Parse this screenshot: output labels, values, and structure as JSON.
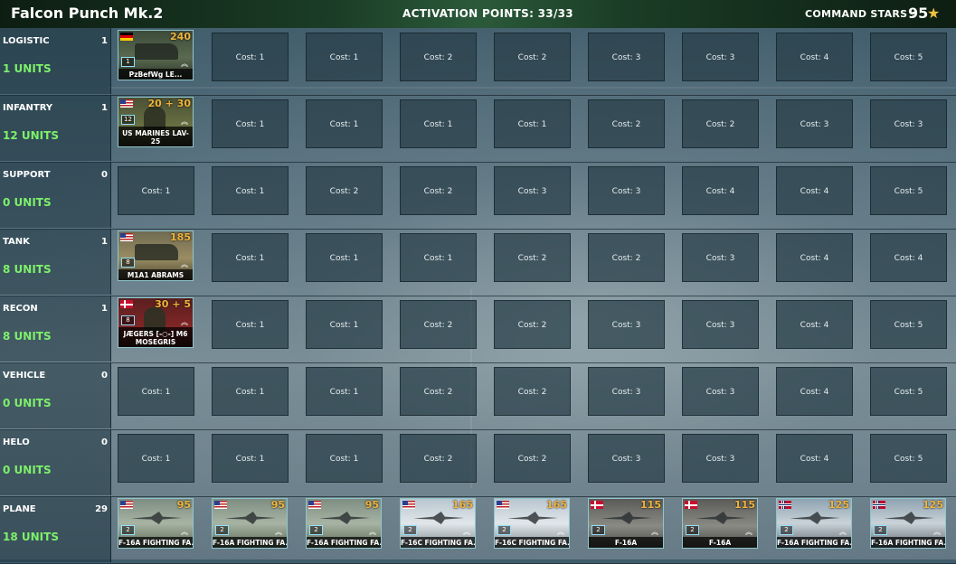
{
  "header": {
    "deck_name": "Falcon Punch Mk.2",
    "activation_points": "ACTIVATION POINTS: 33/33",
    "command_stars_label": "COMMAND STARS :",
    "command_stars_value": "95",
    "star_glyph": "★"
  },
  "rows": [
    {
      "category": "LOGISTIC",
      "count": "1",
      "units": "1 UNITS",
      "card": {
        "name": "PzBefWg LE...",
        "price": "240",
        "qty": "1",
        "flag": "de"
      },
      "slots": [
        "Cost: 1",
        "Cost: 1",
        "Cost: 2",
        "Cost: 2",
        "Cost: 3",
        "Cost: 3",
        "Cost: 4",
        "Cost: 5"
      ]
    },
    {
      "category": "INFANTRY",
      "count": "1",
      "units": "12 UNITS",
      "card": {
        "name": "US MARINES LAV-25",
        "price": "20 + 30",
        "qty": "12",
        "flag": "us"
      },
      "slots": [
        "Cost: 1",
        "Cost: 1",
        "Cost: 1",
        "Cost: 1",
        "Cost: 2",
        "Cost: 2",
        "Cost: 3",
        "Cost: 3"
      ]
    },
    {
      "category": "SUPPORT",
      "count": "0",
      "units": "0 UNITS",
      "slots": [
        "Cost: 1",
        "Cost: 1",
        "Cost: 2",
        "Cost: 2",
        "Cost: 3",
        "Cost: 3",
        "Cost: 4",
        "Cost: 4",
        "Cost: 5"
      ]
    },
    {
      "category": "TANK",
      "count": "1",
      "units": "8 UNITS",
      "card": {
        "name": "M1A1 ABRAMS",
        "price": "185",
        "qty": "8",
        "flag": "us"
      },
      "slots": [
        "Cost: 1",
        "Cost: 1",
        "Cost: 1",
        "Cost: 2",
        "Cost: 2",
        "Cost: 3",
        "Cost: 4",
        "Cost: 4"
      ]
    },
    {
      "category": "RECON",
      "count": "1",
      "units": "8 UNITS",
      "card": {
        "name": "JÆGERS [-○-] M6 MOSEGRIS",
        "price": "30 + 5",
        "qty": "8",
        "flag": "dk"
      },
      "slots": [
        "Cost: 1",
        "Cost: 1",
        "Cost: 2",
        "Cost: 2",
        "Cost: 3",
        "Cost: 3",
        "Cost: 4",
        "Cost: 5"
      ]
    },
    {
      "category": "VEHICLE",
      "count": "0",
      "units": "0 UNITS",
      "slots": [
        "Cost: 1",
        "Cost: 1",
        "Cost: 1",
        "Cost: 2",
        "Cost: 2",
        "Cost: 3",
        "Cost: 3",
        "Cost: 4",
        "Cost: 5"
      ]
    },
    {
      "category": "HELO",
      "count": "0",
      "units": "0 UNITS",
      "slots": [
        "Cost: 1",
        "Cost: 1",
        "Cost: 1",
        "Cost: 2",
        "Cost: 2",
        "Cost: 3",
        "Cost: 3",
        "Cost: 4",
        "Cost: 5"
      ]
    },
    {
      "category": "PLANE",
      "count": "29",
      "units": "18 UNITS",
      "planes": [
        {
          "name": "F-16A FIGHTING FA...",
          "price": "95",
          "qty": "2",
          "flag": "us"
        },
        {
          "name": "F-16A FIGHTING FA...",
          "price": "95",
          "qty": "2",
          "flag": "us"
        },
        {
          "name": "F-16A FIGHTING FA...",
          "price": "95",
          "qty": "2",
          "flag": "us"
        },
        {
          "name": "F-16C FIGHTING FA...",
          "price": "165",
          "qty": "2",
          "flag": "us"
        },
        {
          "name": "F-16C FIGHTING FA...",
          "price": "165",
          "qty": "2",
          "flag": "us"
        },
        {
          "name": "F-16A",
          "price": "115",
          "qty": "2",
          "flag": "dk"
        },
        {
          "name": "F-16A",
          "price": "115",
          "qty": "2",
          "flag": "dk"
        },
        {
          "name": "F-16A FIGHTING FA...",
          "price": "125",
          "qty": "2",
          "flag": "no"
        },
        {
          "name": "F-16A FIGHTING FA...",
          "price": "125",
          "qty": "2",
          "flag": "no"
        }
      ]
    }
  ]
}
